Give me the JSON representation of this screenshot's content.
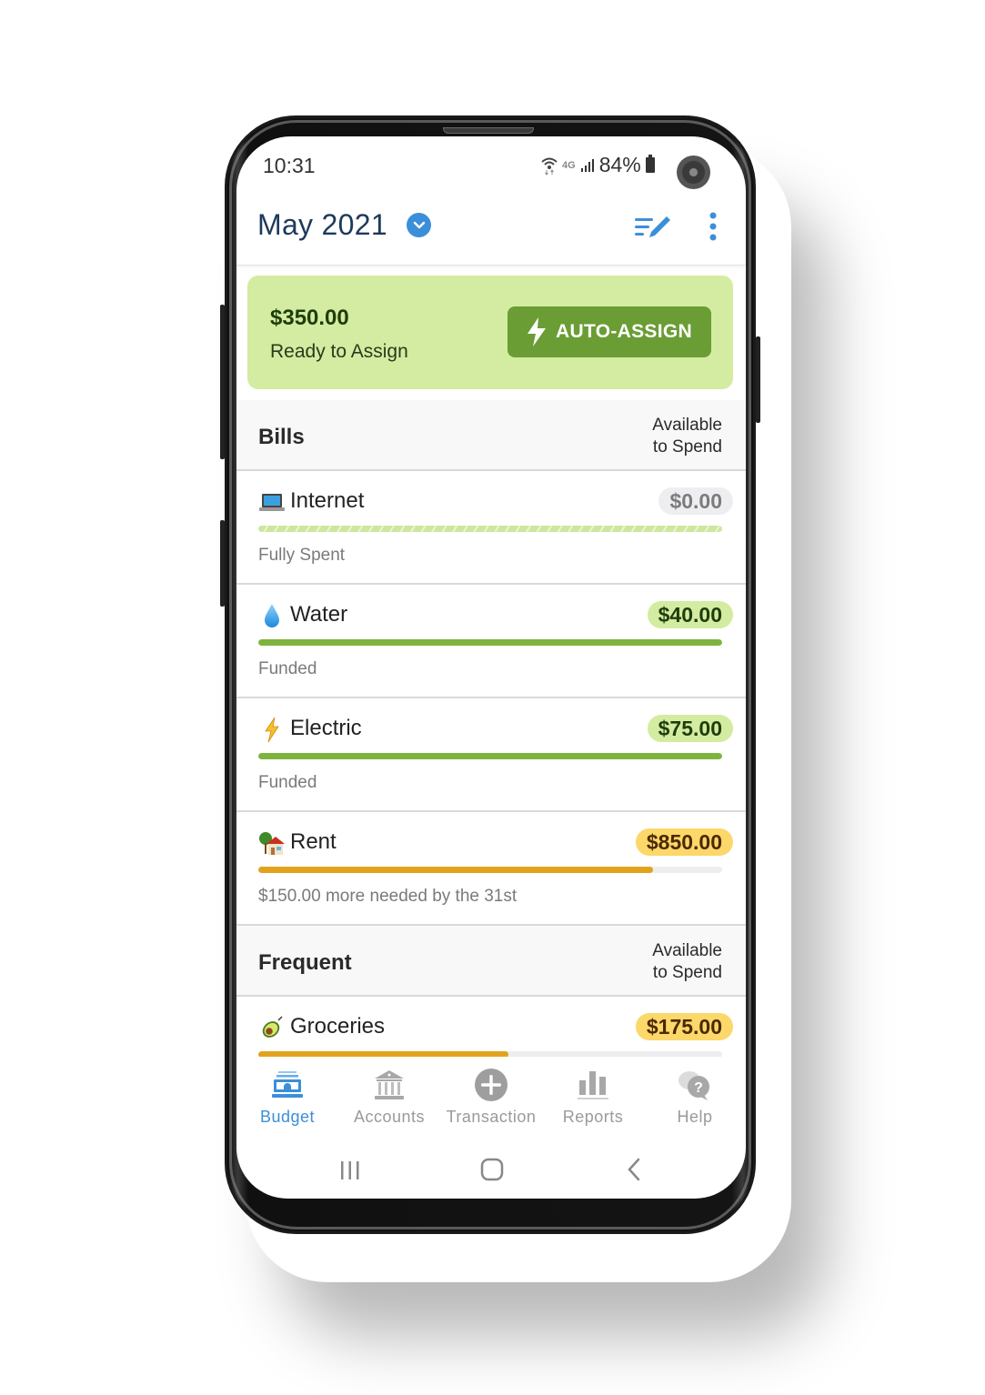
{
  "status_bar": {
    "time": "10:31",
    "network": "4G",
    "battery_percent": "84%"
  },
  "header": {
    "month": "May 2021",
    "month_dropdown_icon": "chevron-down-icon",
    "edit_icon": "edit-list-icon",
    "more_icon": "more-vertical-icon"
  },
  "ready_to_assign": {
    "amount": "$350.00",
    "label": "Ready to Assign",
    "button_label": "AUTO-ASSIGN",
    "button_icon": "lightning-icon"
  },
  "groups": [
    {
      "name": "Bills",
      "column_label_1": "Available",
      "column_label_2": "to Spend",
      "categories": [
        {
          "emoji": "laptop",
          "name": "Internet",
          "available": "$0.00",
          "status": "Fully Spent",
          "progress": 1.0,
          "style": "spent"
        },
        {
          "emoji": "droplet",
          "name": "Water",
          "available": "$40.00",
          "status": "Funded",
          "progress": 1.0,
          "style": "funded"
        },
        {
          "emoji": "lightning",
          "name": "Electric",
          "available": "$75.00",
          "status": "Funded",
          "progress": 1.0,
          "style": "funded"
        },
        {
          "emoji": "house",
          "name": "Rent",
          "available": "$850.00",
          "status": "$150.00 more needed by the 31st",
          "progress": 0.85,
          "style": "underfunded"
        }
      ]
    },
    {
      "name": "Frequent",
      "column_label_1": "Available",
      "column_label_2": "to Spend",
      "categories": [
        {
          "emoji": "avocado",
          "name": "Groceries",
          "available": "$175.00",
          "status": "",
          "progress": 0.54,
          "style": "underfunded"
        }
      ]
    }
  ],
  "bottom_nav": [
    {
      "label": "Budget",
      "icon": "budget-icon",
      "active": true
    },
    {
      "label": "Accounts",
      "icon": "bank-icon",
      "active": false
    },
    {
      "label": "Transaction",
      "icon": "plus-circle-icon",
      "active": false
    },
    {
      "label": "Reports",
      "icon": "bar-chart-icon",
      "active": false
    },
    {
      "label": "Help",
      "icon": "help-chat-icon",
      "active": false
    }
  ],
  "colors": {
    "accent_blue": "#3b8fd9",
    "title_navy": "#1d3a5a",
    "rta_bg": "#d3eca1",
    "button_green": "#6a9d34",
    "funded_green": "#7db43e",
    "underfunded_yellow": "#e1a31b",
    "pill_yellow": "#fcd76a"
  }
}
